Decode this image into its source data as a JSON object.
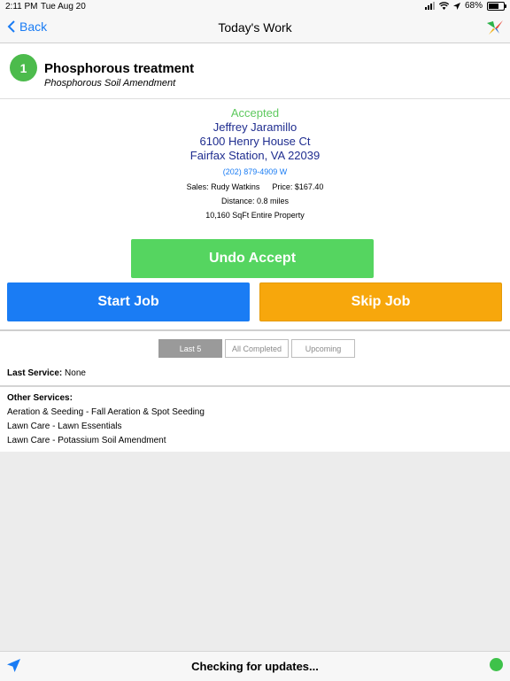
{
  "status_bar": {
    "time": "2:11 PM",
    "date": "Tue Aug 20",
    "battery": "68%",
    "battery_level": 0.68
  },
  "nav": {
    "back_label": "Back",
    "title": "Today's Work",
    "logo_icon": "hummingbird-logo"
  },
  "job": {
    "number": "1",
    "title": "Phosphorous treatment",
    "subtitle": "Phosphorous Soil Amendment"
  },
  "customer": {
    "status": "Accepted",
    "name": "Jeffrey Jaramillo",
    "address_line1": "6100 Henry House Ct",
    "address_line2": "Fairfax Station, VA 22039",
    "phone": "(202) 879-4909 W",
    "sales": "Sales: Rudy Watkins",
    "price": "Price: $167.40",
    "distance": "Distance: 0.8 miles",
    "area": "10,160 SqFt Entire Property"
  },
  "actions": {
    "undo_accept": "Undo Accept",
    "start_job": "Start Job",
    "skip_job": "Skip Job"
  },
  "history_tabs": [
    {
      "label": "Last 5",
      "active": true
    },
    {
      "label": "All Completed",
      "active": false
    },
    {
      "label": "Upcoming",
      "active": false
    }
  ],
  "last_service": {
    "label": "Last Service:",
    "value": "None"
  },
  "other_services": {
    "label": "Other Services:",
    "items": [
      "Aeration & Seeding - Fall Aeration & Spot Seeding",
      "Lawn Care - Lawn Essentials",
      "Lawn Care - Potassium Soil Amendment"
    ]
  },
  "bottom_bar": {
    "status_text": "Checking for updates..."
  },
  "colors": {
    "accent": "#1a7cf4",
    "accepted": "#5ec95e",
    "undo": "#55d560",
    "skip": "#f7a70c",
    "customer_text": "#1f2d8f",
    "online": "#3ec24a"
  }
}
